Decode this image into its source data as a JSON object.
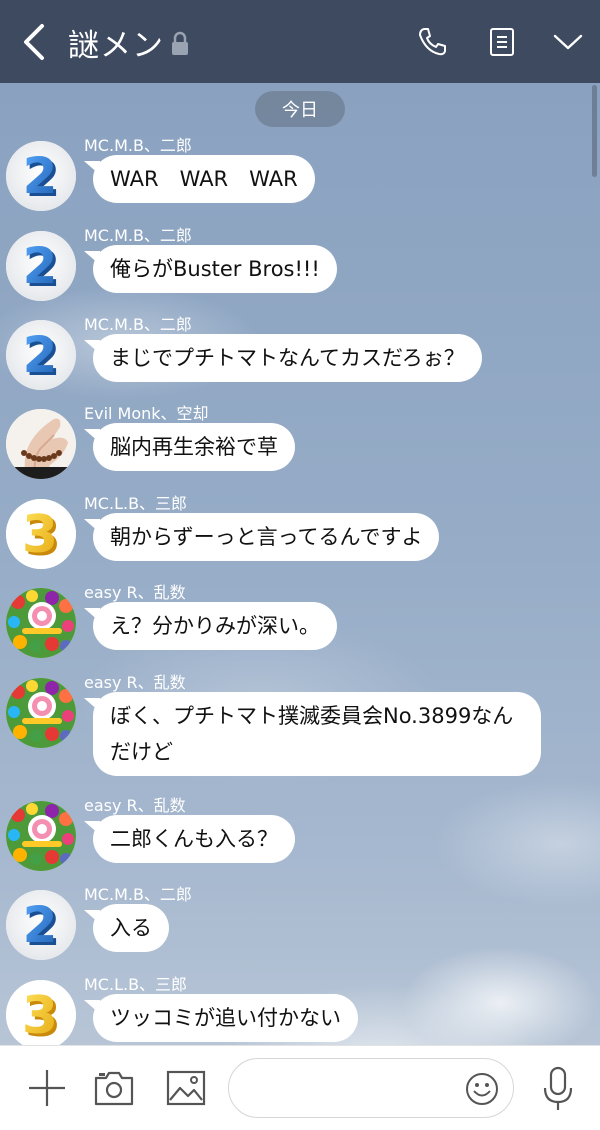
{
  "header": {
    "title": "謎メン",
    "icons": [
      "back-arrow-icon",
      "lock-icon",
      "call-icon",
      "notes-icon",
      "chevron-down-icon"
    ]
  },
  "chat": {
    "date_label": "今日",
    "messages": [
      {
        "sender": "MC.M.B、二郎",
        "avatar": "number-2-avatar",
        "text": "WAR　WAR　WAR"
      },
      {
        "sender": "MC.M.B、二郎",
        "avatar": "number-2-avatar",
        "text": "俺らがBuster Bros!!!"
      },
      {
        "sender": "MC.M.B、二郎",
        "avatar": "number-2-avatar",
        "text": "まじでプチトマトなんてカスだろぉ？"
      },
      {
        "sender": "Evil Monk、空却",
        "avatar": "prayer-beads-hand-avatar",
        "text": "脳内再生余裕で草"
      },
      {
        "sender": "MC.L.B、三郎",
        "avatar": "number-3-avatar",
        "text": "朝からずーっと言ってるんですよ"
      },
      {
        "sender": "easy R、乱数",
        "avatar": "candy-avatar",
        "text": "え？分かりみが深い。"
      },
      {
        "sender": "easy R、乱数",
        "avatar": "candy-avatar",
        "text": "ぼく、プチトマト撲滅委員会No.3899なんだけど"
      },
      {
        "sender": "easy R、乱数",
        "avatar": "candy-avatar",
        "text": "二郎くんも入る？"
      },
      {
        "sender": "MC.M.B、二郎",
        "avatar": "number-2-avatar",
        "text": "入る"
      },
      {
        "sender": "MC.L.B、三郎",
        "avatar": "number-3-avatar",
        "text": "ツッコミが追い付かない"
      }
    ]
  },
  "input_bar": {
    "placeholder": "",
    "icons": [
      "plus-icon",
      "camera-icon",
      "image-icon",
      "emoji-icon",
      "microphone-icon"
    ]
  },
  "colors": {
    "header_bg": "#3e4a60",
    "bubble_bg": "#ffffff",
    "date_pill_bg": "#6e7d91",
    "chat_bg": "#8fa6c2",
    "avatar_blue": "#2f7fd6",
    "avatar_yellow": "#f2c31b"
  }
}
